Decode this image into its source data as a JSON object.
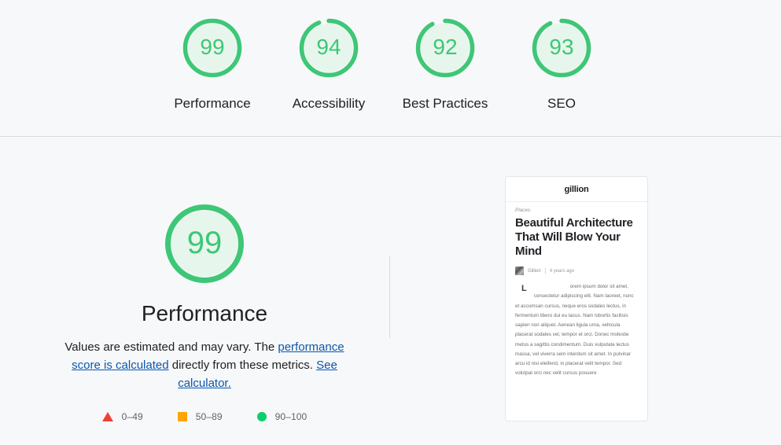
{
  "colors": {
    "pass": "#0cce6b",
    "pass_stroke": "#3dc776",
    "pass_fill": "#e7f6ec",
    "average": "#ffa400",
    "fail": "#f04033",
    "link": "#0b57ae",
    "page_bg": "#f7f8f9",
    "divider": "#dcdcdf"
  },
  "summary": {
    "gauges": [
      {
        "score": "99",
        "label": "Performance",
        "pct": 99,
        "icon": "score-gauge-arc"
      },
      {
        "score": "94",
        "label": "Accessibility",
        "pct": 94,
        "icon": "score-gauge-arc"
      },
      {
        "score": "92",
        "label": "Best Practices",
        "pct": 92,
        "icon": "score-gauge-arc"
      },
      {
        "score": "93",
        "label": "SEO",
        "pct": 93,
        "icon": "score-gauge-arc"
      }
    ]
  },
  "performance": {
    "score": "99",
    "pct": 99,
    "title": "Performance",
    "description_parts": {
      "t1": "Values are estimated and may vary. The ",
      "link1": "performance score is calculated",
      "t2": " directly from these metrics. ",
      "link2": "See calculator.",
      "t3": ""
    },
    "legend": [
      {
        "icon": "fail-triangle-icon",
        "shape": "triangle",
        "color": "#f04033",
        "range": "0–49"
      },
      {
        "icon": "average-square-icon",
        "shape": "square",
        "color": "#ffa400",
        "range": "50–89"
      },
      {
        "icon": "pass-circle-icon",
        "shape": "circle",
        "color": "#0cce6b",
        "range": "90–100"
      }
    ]
  },
  "screenshot_thumb": {
    "site_logo": "gillion",
    "category": "Places",
    "headline": "Beautiful Architecture That Will Blow Your Mind",
    "author": "Gillion",
    "date": "4 years ago",
    "dropcap": "L",
    "body": "orem ipsum dolor sit amet, consectetur adipiscing elit. Nam laoreet, nunc et accumsan cursus, neque eros sodales lectus, in fermentum libero dui eu lacus. Nam lobortis facilisis sapien non aliquet. Aenean ligula urna, vehicula placerat sodales vel, tempor et orci. Donec molestie metus a sagittis condimentum. Duis vulputate lectus massa, vel viverra sem interdum sit amet. In pulvinar arcu id nisi eleifend, in placerat velit tempor. Sed volutpat orci nec velit cursus posuere"
  }
}
